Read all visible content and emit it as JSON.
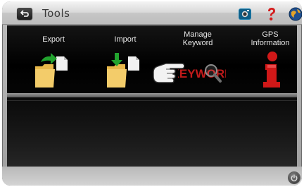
{
  "window": {
    "title": "Tools"
  },
  "topbar": {
    "back_icon": "back-arrow-icon",
    "camera_icon": "camera-icon",
    "help_icon": "help-question-icon",
    "globe_icon": "globe-icon"
  },
  "tools": [
    {
      "label": "Export",
      "icon": "export-folder-icon"
    },
    {
      "label": "Import",
      "icon": "import-folder-icon"
    },
    {
      "label": "Manage\nKeyword",
      "label_line1": "Manage",
      "label_line2": "Keyword",
      "icon": "keyword-icon",
      "icon_text": "KEYWORD"
    },
    {
      "label": "GPS\nInformation",
      "label_line1": "GPS",
      "label_line2": "Information",
      "icon": "info-icon"
    }
  ],
  "bottom": {
    "power_icon": "power-icon"
  },
  "colors": {
    "accent_green": "#22a32e",
    "info_red": "#d01818",
    "keyword_red": "#c01a1a"
  }
}
